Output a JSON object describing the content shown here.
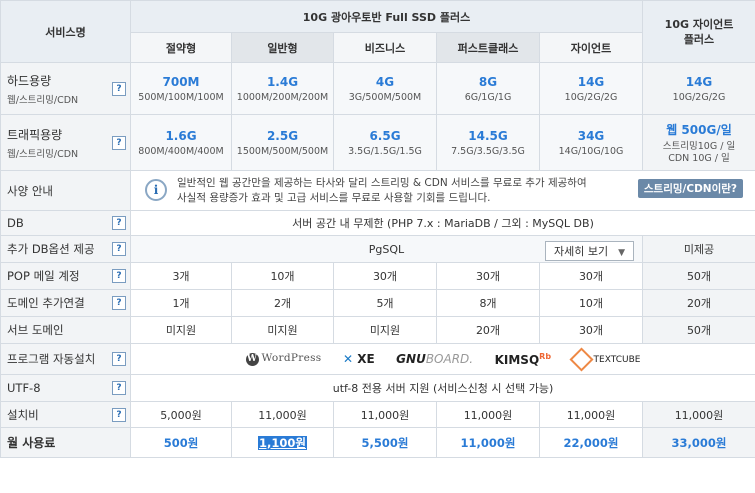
{
  "header": {
    "service_label": "서비스명",
    "group_title": "10G 광아우토반 Full SSD 플러스",
    "plans": [
      "절약형",
      "일반형",
      "비즈니스",
      "퍼스트클래스",
      "자이언트"
    ],
    "side_title": "10G 자이언트\n플러스"
  },
  "rows": {
    "disk": {
      "label": "하드용량",
      "sub": "웹/스트리밍/CDN",
      "values": [
        "700M",
        "1.4G",
        "4G",
        "8G",
        "14G",
        "14G"
      ],
      "details": [
        "500M/100M/100M",
        "1000M/200M/200M",
        "3G/500M/500M",
        "6G/1G/1G",
        "10G/2G/2G",
        "10G/2G/2G"
      ]
    },
    "traffic": {
      "label": "트래픽용량",
      "sub": "웹/스트리밍/CDN",
      "values": [
        "1.6G",
        "2.5G",
        "6.5G",
        "14.5G",
        "34G",
        "웹 500G/일"
      ],
      "details": [
        "800M/400M/400M",
        "1500M/500M/500M",
        "3.5G/1.5G/1.5G",
        "7.5G/3.5G/3.5G",
        "14G/10G/10G",
        "스트리밍10G / 일\nCDN 10G / 일"
      ]
    },
    "spec": {
      "label": "사양 안내",
      "text": "일반적인 웹 공간만을 제공하는 타사와 달리 스트리밍 & CDN 서비스를 무료로 추가 제공하여 사실적 용량증가 효과 및 고급 서비스를 무료로 사용할 기회를 드립니다.",
      "button": "스트리밍/CDN이란?"
    },
    "db": {
      "label": "DB",
      "value": "서버 공간 내 무제한 (PHP 7.x : MariaDB / 그외 : MySQL DB)"
    },
    "db_option": {
      "label": "추가 DB옵션 제공",
      "value": "PgSQL",
      "detail_button": "자세히 보기",
      "side": "미제공"
    },
    "pop": {
      "label": "POP 메일 계정",
      "values": [
        "3개",
        "10개",
        "30개",
        "30개",
        "30개",
        "50개"
      ]
    },
    "domain": {
      "label": "도메인 추가연결",
      "values": [
        "1개",
        "2개",
        "5개",
        "8개",
        "10개",
        "20개"
      ]
    },
    "subdomain": {
      "label": "서브 도메인",
      "values": [
        "미지원",
        "미지원",
        "미지원",
        "20개",
        "30개",
        "50개"
      ]
    },
    "autoinstall": {
      "label": "프로그램 자동설치",
      "logos": [
        "WordPress",
        "XE",
        "GNUBOARD.",
        "KIMSQ Rb",
        "TEXTCUBE"
      ]
    },
    "utf8": {
      "label": "UTF-8",
      "value": "utf-8 전용 서버 지원 (서비스신청 시 선택 가능)"
    },
    "setup": {
      "label": "설치비",
      "values": [
        "5,000원",
        "11,000원",
        "11,000원",
        "11,000원",
        "11,000원",
        "11,000원"
      ]
    },
    "monthly": {
      "label": "월 사용료",
      "values": [
        "500원",
        "1,100원",
        "5,500원",
        "11,000원",
        "22,000원",
        "33,000원"
      ]
    }
  },
  "help_mark": "?",
  "colors": {
    "accent": "#2a7bd6",
    "header_bg": "#e9eef3",
    "label_bg": "#f2f4f6",
    "border": "#d5dbe2"
  }
}
